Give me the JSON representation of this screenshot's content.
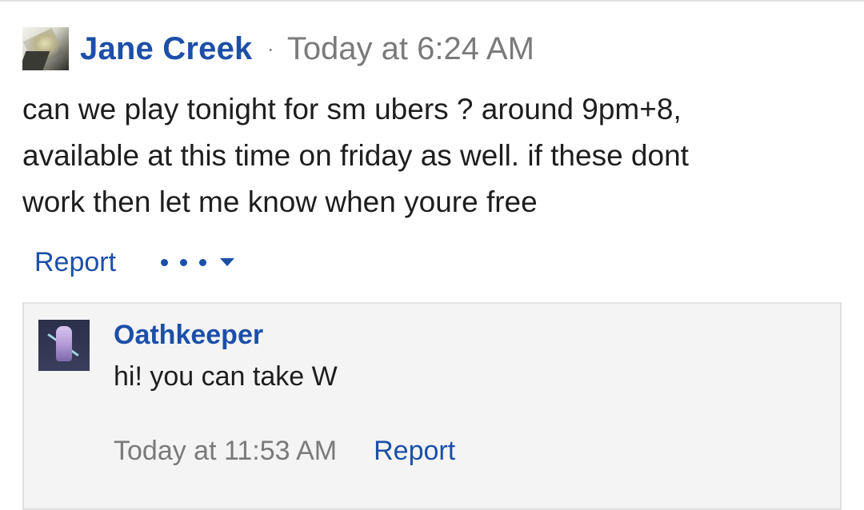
{
  "post": {
    "author": "Jane Creek",
    "separator": "·",
    "timestamp": "Today at 6:24 AM",
    "body_lines": [
      "can we play tonight for sm ubers ? around 9pm+8,",
      "available at this time on friday as well. if these dont",
      "work then let me know when youre free"
    ],
    "report_label": "Report",
    "more_menu_icon": "ellipsis-dropdown-icon"
  },
  "reply": {
    "author": "Oathkeeper",
    "text": "hi! you can take W",
    "timestamp": "Today at 11:53 AM",
    "report_label": "Report"
  },
  "colors": {
    "link": "#1c4fa8",
    "muted": "#7a7a7a",
    "reply_background": "#f4f4f4"
  }
}
